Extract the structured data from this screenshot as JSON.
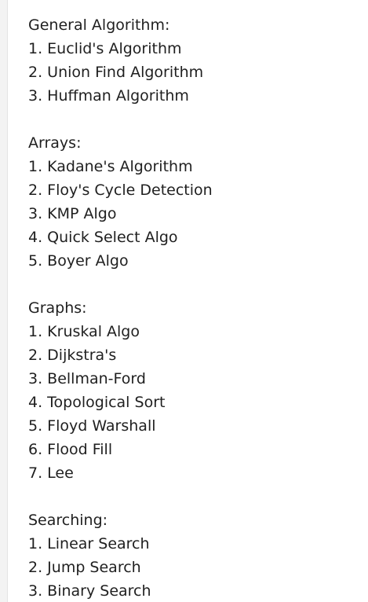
{
  "sections": [
    {
      "heading": "General Algorithm:",
      "items": [
        "1. Euclid's Algorithm",
        "2. Union Find Algorithm",
        "3. Huffman Algorithm"
      ]
    },
    {
      "heading": "Arrays:",
      "items": [
        "1. Kadane's Algorithm",
        "2. Floy's Cycle Detection",
        "3. KMP Algo",
        "4. Quick Select Algo",
        "5. Boyer Algo"
      ]
    },
    {
      "heading": "Graphs:",
      "items": [
        "1. Kruskal Algo",
        "2. Dijkstra's",
        "3. Bellman-Ford",
        "4. Topological Sort",
        "5. Floyd Warshall",
        "6. Flood Fill",
        "7. Lee"
      ]
    },
    {
      "heading": "Searching:",
      "items": [
        "1. Linear Search",
        "2. Jump Search",
        "3. Binary Search"
      ]
    }
  ]
}
